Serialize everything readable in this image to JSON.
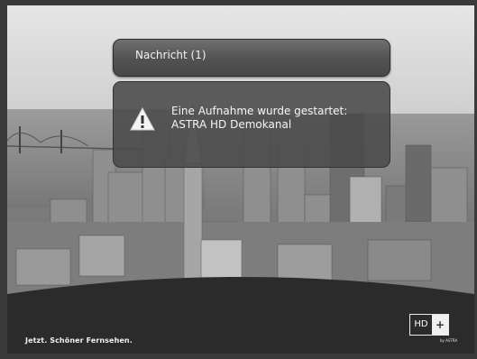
{
  "message_header": {
    "title": "Nachricht (1)"
  },
  "message_body": {
    "icon": "warning-icon",
    "line1": "Eine Aufnahme wurde gestartet:",
    "line2": "ASTRA HD Demokanal"
  },
  "footer": {
    "slogan": "Jetzt. Schöner Fernsehen.",
    "logo": {
      "hd": "HD",
      "plus": "+",
      "by": "by ASTRA"
    }
  },
  "colors": {
    "panel": "#4f4f4f",
    "text": "#f5f5f5"
  }
}
